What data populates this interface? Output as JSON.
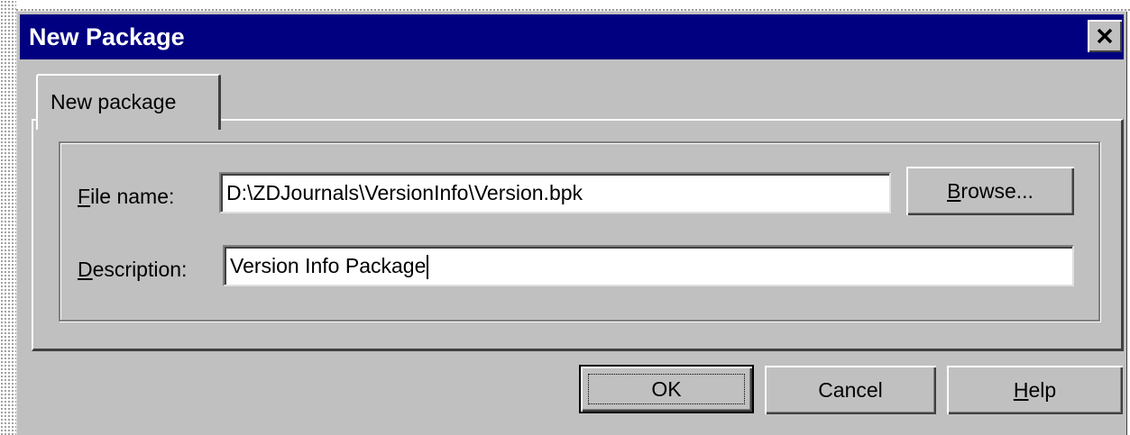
{
  "dialog": {
    "title": "New Package",
    "close_icon": "close-icon"
  },
  "tabs": [
    {
      "label": "New package",
      "selected": true
    }
  ],
  "fields": {
    "file_name": {
      "label_access_key": "F",
      "label_rest": "ile name:",
      "value": "D:\\ZDJournals\\VersionInfo\\Version.bpk"
    },
    "description": {
      "label_access_key": "D",
      "label_rest": "escription:",
      "value": "Version Info Package"
    }
  },
  "buttons": {
    "browse": {
      "access_key": "B",
      "rest": "rowse..."
    },
    "ok": {
      "label": "OK"
    },
    "cancel": {
      "label": "Cancel"
    },
    "help": {
      "access_key": "H",
      "rest": "elp"
    }
  },
  "colors": {
    "titlebar": "#000080",
    "dialog_face": "#c0c0c0"
  }
}
